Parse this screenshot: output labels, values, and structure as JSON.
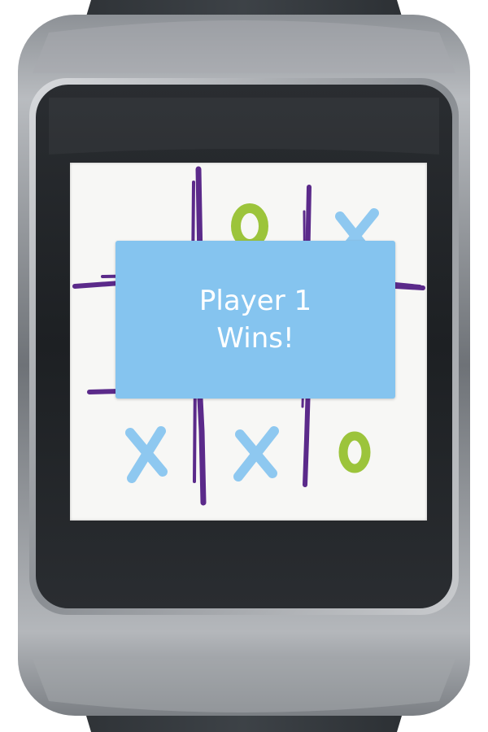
{
  "game": {
    "board": [
      [
        "",
        "O",
        "X"
      ],
      [
        "",
        "",
        ""
      ],
      [
        "X",
        "X",
        "O"
      ]
    ],
    "result_line1": "Player 1",
    "result_line2": "Wins!"
  },
  "colors": {
    "grid": "#5b2a8a",
    "x_mark": "#8ec8f0",
    "o_mark": "#9cc43b",
    "dialog": "#85c4ef",
    "dialog_text": "#ffffff",
    "screen": "#f7f7f5"
  }
}
